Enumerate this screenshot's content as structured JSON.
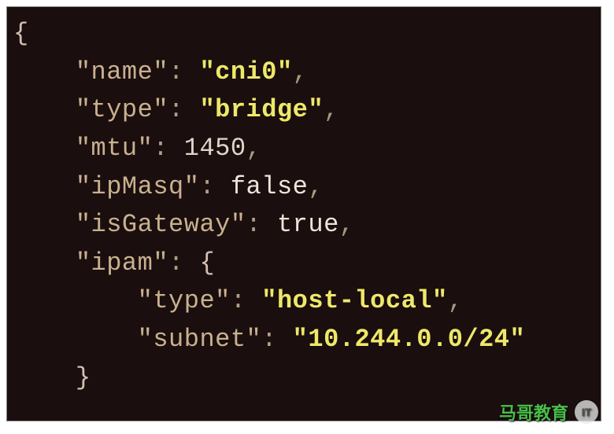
{
  "code": {
    "open_brace": "{",
    "line1_key": "\"name\"",
    "line1_val": "\"cni0\"",
    "line2_key": "\"type\"",
    "line2_val": "\"bridge\"",
    "line3_key": "\"mtu\"",
    "line3_val": "1450",
    "line4_key": "\"ipMasq\"",
    "line4_val": "false",
    "line5_key": "\"isGateway\"",
    "line5_val": "true",
    "line6_key": "\"ipam\"",
    "line6_open": "{",
    "line7_key": "\"type\"",
    "line7_val": "\"host-local\"",
    "line8_key": "\"subnet\"",
    "line8_val": "\"10.244.0.0/24\"",
    "line9_close": "}",
    "colon": ":",
    "comma": ","
  },
  "watermark": {
    "text": "马哥教育"
  }
}
